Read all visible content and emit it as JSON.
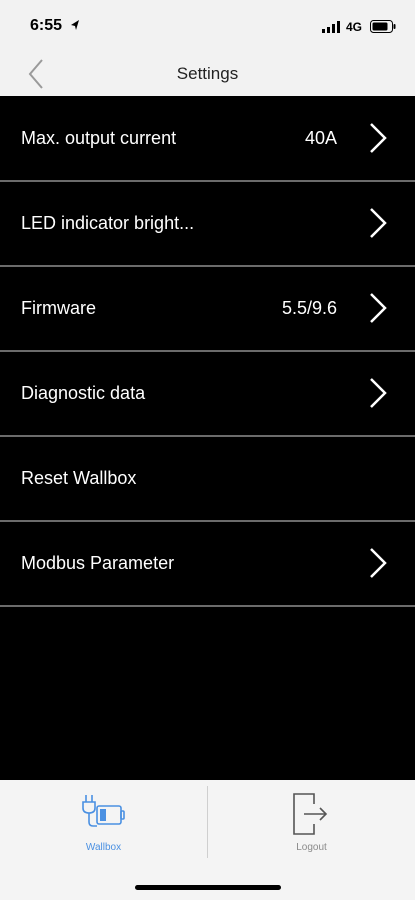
{
  "status_bar": {
    "time": "6:55",
    "network": "4G"
  },
  "nav": {
    "title": "Settings"
  },
  "rows": [
    {
      "label": "Max. output current",
      "value": "40A",
      "has_chevron": true
    },
    {
      "label": "LED indicator bright...",
      "value": "",
      "has_chevron": true
    },
    {
      "label": "Firmware",
      "value": "5.5/9.6",
      "has_chevron": true
    },
    {
      "label": "Diagnostic data",
      "value": "",
      "has_chevron": true
    },
    {
      "label": "Reset Wallbox",
      "value": "",
      "has_chevron": false
    },
    {
      "label": "Modbus Parameter",
      "value": "",
      "has_chevron": true
    }
  ],
  "tabs": [
    {
      "label": "Wallbox",
      "icon": "charger-plug-icon",
      "active": true
    },
    {
      "label": "Logout",
      "icon": "logout-icon",
      "active": false
    }
  ],
  "colors": {
    "accent": "#4a90e2",
    "list_background": "#000000",
    "separator": "#6b6b6b",
    "bar_background": "#f2f2f2"
  }
}
